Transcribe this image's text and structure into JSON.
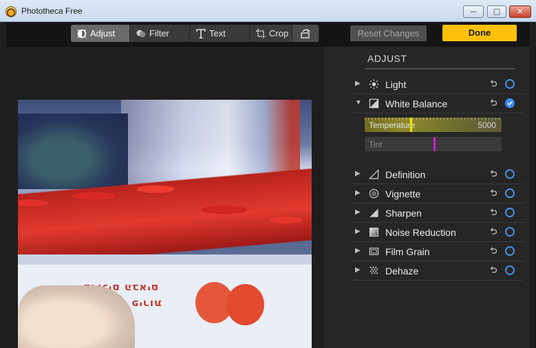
{
  "window": {
    "title": "Phototheca Free"
  },
  "toolbar": {
    "tabs": [
      {
        "label": "Adjust",
        "icon": "adjust-icon",
        "active": true
      },
      {
        "label": "Filter",
        "icon": "filter-icon",
        "active": false
      },
      {
        "label": "Text",
        "icon": "text-icon",
        "active": false
      },
      {
        "label": "Crop",
        "icon": "crop-icon",
        "active": false
      }
    ],
    "rotate_icon": "rotate-icon",
    "reset_label": "Reset Changes",
    "done_label": "Done"
  },
  "panel": {
    "title": "ADJUST",
    "items": [
      {
        "label": "Light",
        "icon": "sun-icon",
        "expanded": false,
        "checked": false
      },
      {
        "label": "White Balance",
        "icon": "white-balance-icon",
        "expanded": true,
        "checked": true
      },
      {
        "label": "Definition",
        "icon": "definition-icon",
        "expanded": false,
        "checked": false
      },
      {
        "label": "Vignette",
        "icon": "vignette-icon",
        "expanded": false,
        "checked": false
      },
      {
        "label": "Sharpen",
        "icon": "sharpen-icon",
        "expanded": false,
        "checked": false
      },
      {
        "label": "Noise Reduction",
        "icon": "noise-reduction-icon",
        "expanded": false,
        "checked": false
      },
      {
        "label": "Film Grain",
        "icon": "film-grain-icon",
        "expanded": false,
        "checked": false
      },
      {
        "label": "Dehaze",
        "icon": "dehaze-icon",
        "expanded": false,
        "checked": false
      }
    ],
    "white_balance": {
      "temperature": {
        "label": "Temperature",
        "value": "5000",
        "level": 0.33
      },
      "tint": {
        "label": "Tint",
        "value": "",
        "level": 0.5
      }
    }
  },
  "photo": {
    "print_line1": "ברוכים הבאים",
    "print_line2": "ירקות - פירות"
  },
  "colors": {
    "accent": "#ffc107",
    "check": "#3b8ff0",
    "tint_thumb": "#d31ed6",
    "temp_thumb": "#f2e600"
  }
}
